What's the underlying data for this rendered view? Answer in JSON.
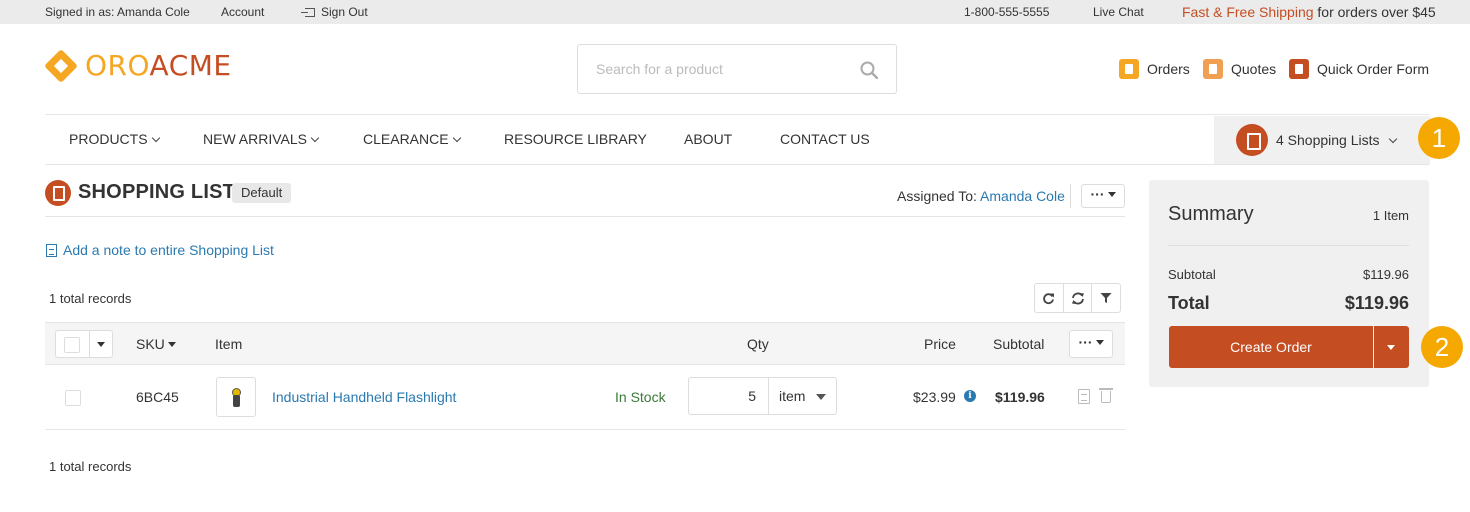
{
  "topbar": {
    "signed_in": "Signed in as: Amanda Cole",
    "account": "Account",
    "sign_out": "Sign Out",
    "phone": "1-800-555-5555",
    "live_chat": "Live Chat",
    "shipping_link": "Fast & Free Shipping",
    "shipping_text": "for orders over $45"
  },
  "logo": {
    "part1": "ORO",
    "part2": "ACME"
  },
  "search": {
    "placeholder": "Search for a product",
    "value": ""
  },
  "header_links": [
    {
      "label": "Orders",
      "icon": "orders-icon",
      "color": "#f5a623"
    },
    {
      "label": "Quotes",
      "icon": "quotes-icon",
      "color": "#f0a050"
    },
    {
      "label": "Quick Order Form",
      "icon": "quick-order-icon",
      "color": "#c54d22"
    }
  ],
  "nav": {
    "items": [
      "PRODUCTS",
      "NEW ARRIVALS",
      "CLEARANCE",
      "RESOURCE LIBRARY",
      "ABOUT",
      "CONTACT US"
    ],
    "shopping_lists": "4 Shopping Lists"
  },
  "badges": [
    "1",
    "2"
  ],
  "shopping_list": {
    "title": "SHOPPING LIST",
    "tag": "Default",
    "assigned_label": "Assigned To:",
    "assigned_user": "Amanda Cole",
    "more_label": "···",
    "note_link": "Add a note to entire Shopping List",
    "records_top": "1 total records",
    "records_bottom": "1 total records"
  },
  "table": {
    "columns": {
      "sku": "SKU",
      "item": "Item",
      "qty": "Qty",
      "price": "Price",
      "subtotal": "Subtotal"
    },
    "rows": [
      {
        "sku": "6BC45",
        "name": "Industrial Handheld Flashlight",
        "stock": "In Stock",
        "qty": "5",
        "unit": "item",
        "price": "$23.99",
        "subtotal": "$119.96"
      }
    ]
  },
  "summary": {
    "title": "Summary",
    "count": "1 Item",
    "subtotal_label": "Subtotal",
    "subtotal_value": "$119.96",
    "total_label": "Total",
    "total_value": "$119.96",
    "create_order": "Create Order"
  },
  "colors": {
    "brand_orange": "#c54d22",
    "brand_yellow": "#f5a623",
    "link_blue": "#2a7ab0",
    "badge": "#f5a800"
  }
}
